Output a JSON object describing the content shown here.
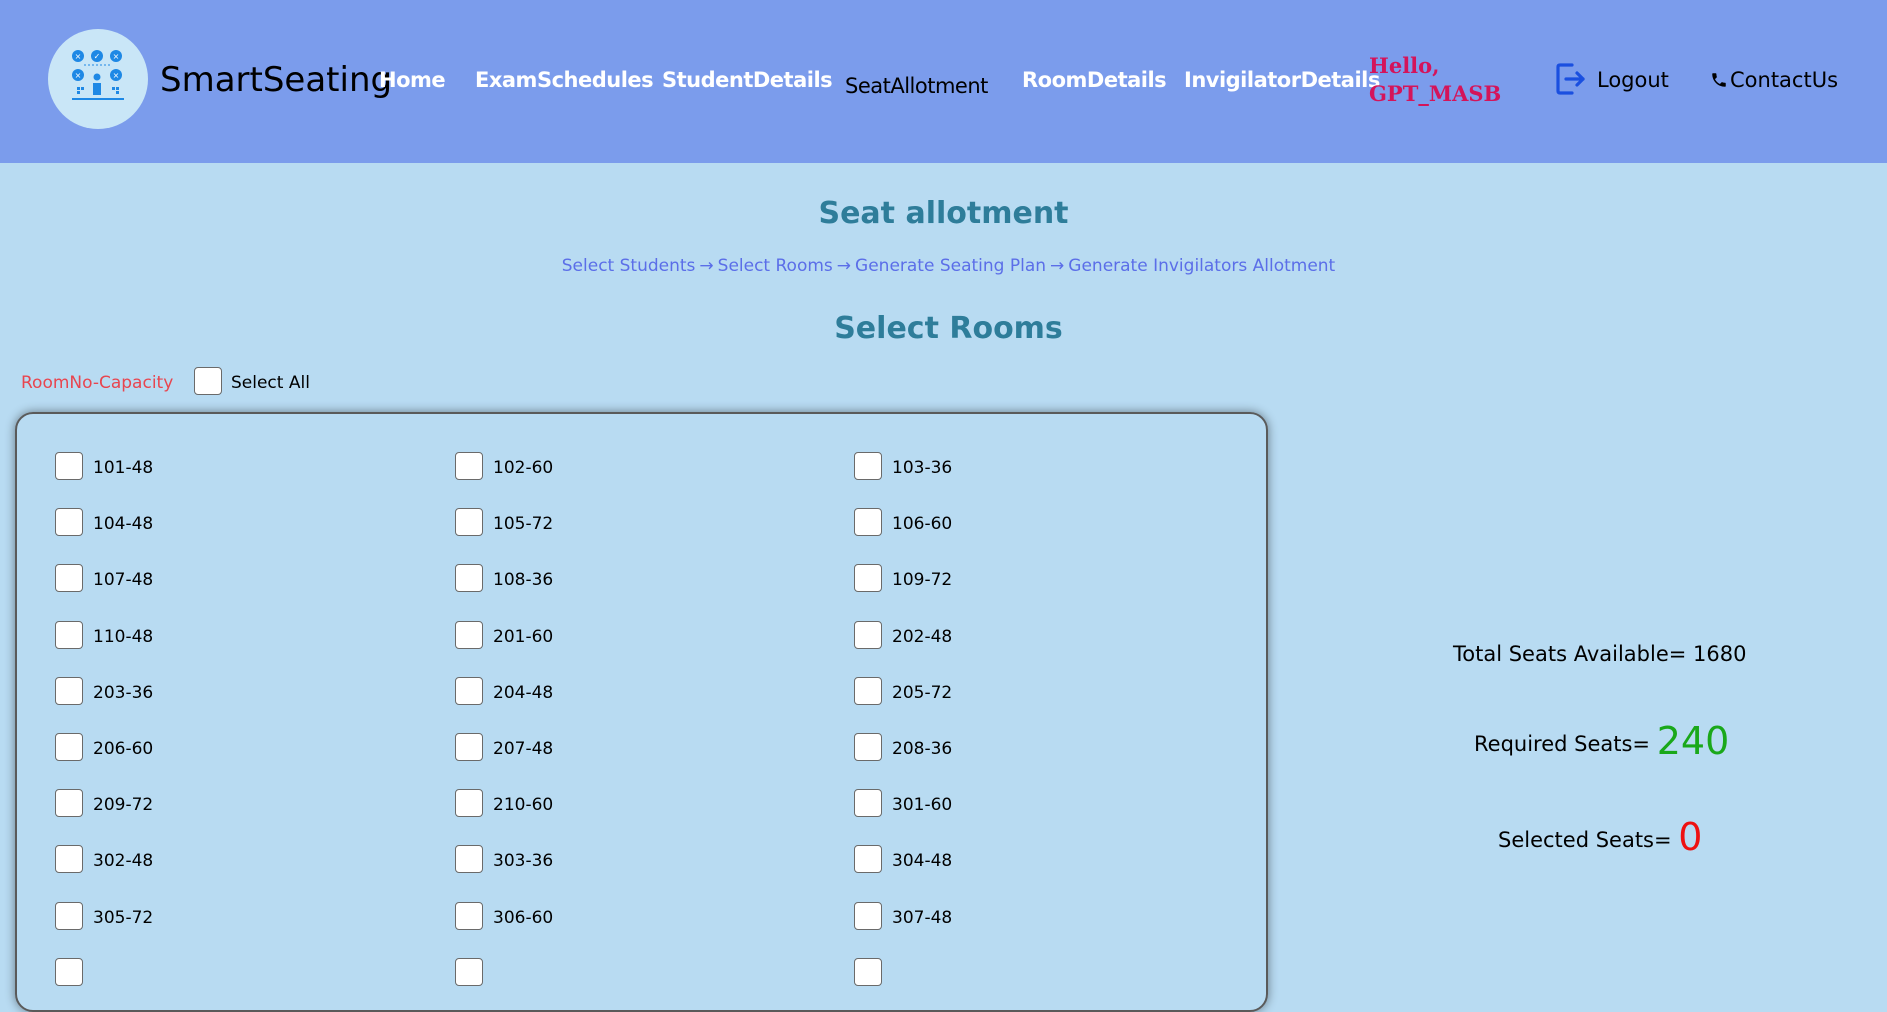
{
  "header": {
    "brand": "SmartSeating",
    "nav": [
      {
        "label": "Home"
      },
      {
        "label": "ExamSchedules"
      },
      {
        "label": "StudentDetails"
      },
      {
        "label": "SeatAllotment"
      },
      {
        "label": "RoomDetails"
      },
      {
        "label": "InvigilatorDetails"
      }
    ],
    "greeting": "Hello,",
    "user": "GPT_MASB",
    "logout_label": "Logout",
    "contact_label": "ContactUs"
  },
  "page": {
    "title": "Seat allotment",
    "steps": [
      "Select Students",
      "Select Rooms",
      "Generate Seating Plan",
      "Generate Invigilators Allotment"
    ],
    "arrow": "→",
    "section_title": "Select Rooms",
    "legend": "RoomNo-Capacity",
    "select_all_label": "Select All"
  },
  "rooms": [
    "101-48",
    "102-60",
    "103-36",
    "104-48",
    "105-72",
    "106-60",
    "107-48",
    "108-36",
    "109-72",
    "110-48",
    "201-60",
    "202-48",
    "203-36",
    "204-48",
    "205-72",
    "206-60",
    "207-48",
    "208-36",
    "209-72",
    "210-60",
    "301-60",
    "302-48",
    "303-36",
    "304-48",
    "305-72",
    "306-60",
    "307-48"
  ],
  "stats": {
    "total_label": "Total Seats Available= 1680",
    "required_label": "Required Seats=",
    "required_value": "240",
    "selected_label": "Selected Seats=",
    "selected_value": "0"
  },
  "colors": {
    "navbar": "#7b9cec",
    "background": "#b8dbf2",
    "title": "#2e7d9a",
    "steps": "#5b6ee8",
    "legend": "#e8454f",
    "greeting": "#d4145a",
    "required": "#1aa81a",
    "selected": "#ee1111"
  }
}
